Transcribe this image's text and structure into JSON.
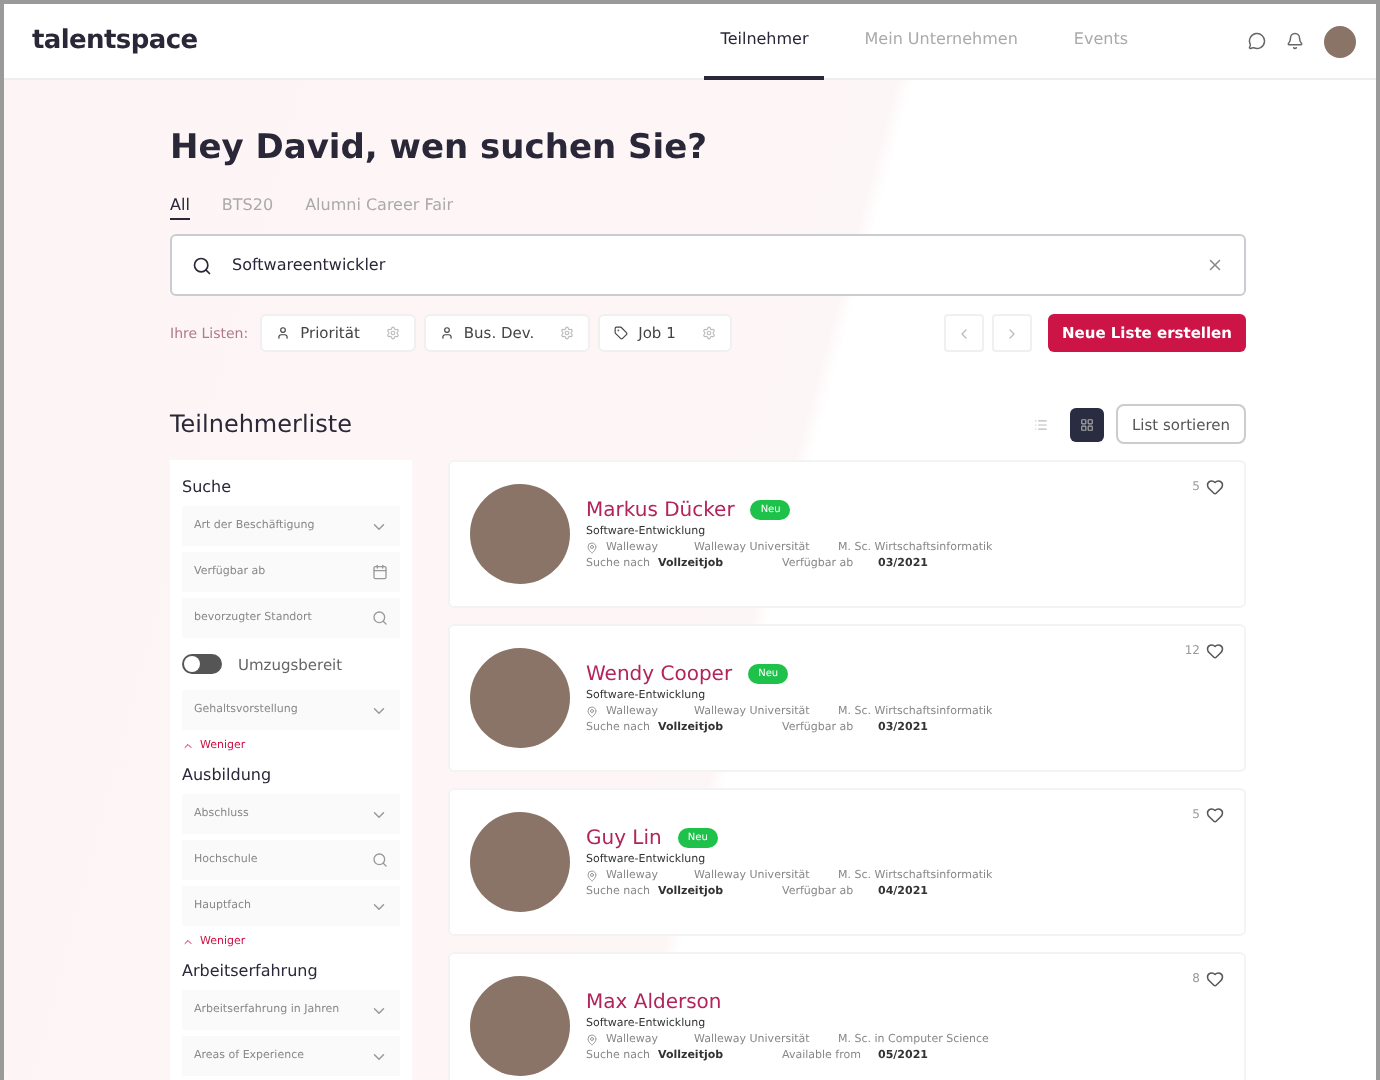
{
  "brand": "talentspace",
  "nav": [
    {
      "label": "Teilnehmer",
      "selected": true
    },
    {
      "label": "Mein Unternehmen",
      "selected": false
    },
    {
      "label": "Events",
      "selected": false
    }
  ],
  "heading": "Hey David, wen suchen Sie?",
  "scope_tabs": [
    {
      "label": "All",
      "selected": true
    },
    {
      "label": "BTS20",
      "selected": false
    },
    {
      "label": "Alumni Career Fair",
      "selected": false
    }
  ],
  "search": {
    "value": "Softwareentwickler"
  },
  "lists_label": "Ihre Listen:",
  "lists": [
    {
      "label": "Priorität",
      "kind": "person"
    },
    {
      "label": "Bus. Dev.",
      "kind": "person"
    },
    {
      "label": "Job 1",
      "kind": "pin"
    }
  ],
  "new_list_button": "Neue Liste erstellen",
  "section_title": "Teilnehmerliste",
  "views": [
    {
      "kind": "list",
      "selected": false
    },
    {
      "kind": "grid",
      "selected": true
    }
  ],
  "sort_button": "List sortieren",
  "filter_groups": [
    {
      "title": "Suche",
      "items": [
        {
          "kind": "select",
          "label": "Art der Beschäftigung"
        },
        {
          "kind": "date",
          "label": "Verfügbar ab"
        },
        {
          "kind": "search",
          "label": "bevorzugter Standort"
        },
        {
          "kind": "toggle",
          "label": "Umzugsbereit",
          "on": false
        },
        {
          "kind": "select",
          "label": "Gehaltsvorstellung"
        },
        {
          "kind": "less",
          "label": "Weniger"
        }
      ]
    },
    {
      "title": "Ausbildung",
      "items": [
        {
          "kind": "select",
          "label": "Abschluss"
        },
        {
          "kind": "search",
          "label": "Hochschule"
        },
        {
          "kind": "select",
          "label": "Hauptfach"
        },
        {
          "kind": "less",
          "label": "Weniger"
        }
      ]
    },
    {
      "title": "Arbeitserfahrung",
      "items": [
        {
          "kind": "select",
          "label": "Arbeitserfahrung in Jahren"
        },
        {
          "kind": "select",
          "label": "Areas of Experience"
        }
      ]
    }
  ],
  "candidates": [
    {
      "name": "Markus Dücker",
      "badge": "Neu",
      "field": "Software-Entwicklung",
      "location": "Walleway",
      "university": "Walleway Universität",
      "degree": "M. Sc. Wirtschaftsinformatik",
      "seeking_label": "Suche nach",
      "seeking": "Vollzeitjob",
      "available_label": "Verfügbar ab",
      "available": "03/2021",
      "likes": "5"
    },
    {
      "name": "Wendy Cooper",
      "badge": "Neu",
      "field": "Software-Entwicklung",
      "location": "Walleway",
      "university": "Walleway Universität",
      "degree": "M. Sc. Wirtschaftsinformatik",
      "seeking_label": "Suche nach",
      "seeking": "Vollzeitjob",
      "available_label": "Verfügbar ab",
      "available": "03/2021",
      "likes": "12"
    },
    {
      "name": "Guy Lin",
      "badge": "Neu",
      "field": "Software-Entwicklung",
      "location": "Walleway",
      "university": "Walleway Universität",
      "degree": "M. Sc. Wirtschaftsinformatik",
      "seeking_label": "Suche nach",
      "seeking": "Vollzeitjob",
      "available_label": "Verfügbar ab",
      "available": "04/2021",
      "likes": "5"
    },
    {
      "name": "Max Alderson",
      "field": "Software-Entwicklung",
      "location": "Walleway",
      "university": "Walleway Universität",
      "degree": "M. Sc. in Computer Science",
      "seeking_label": "Suche nach",
      "seeking": "Vollzeitjob",
      "available_label": "Available from",
      "available": "05/2021",
      "likes": "8"
    }
  ]
}
